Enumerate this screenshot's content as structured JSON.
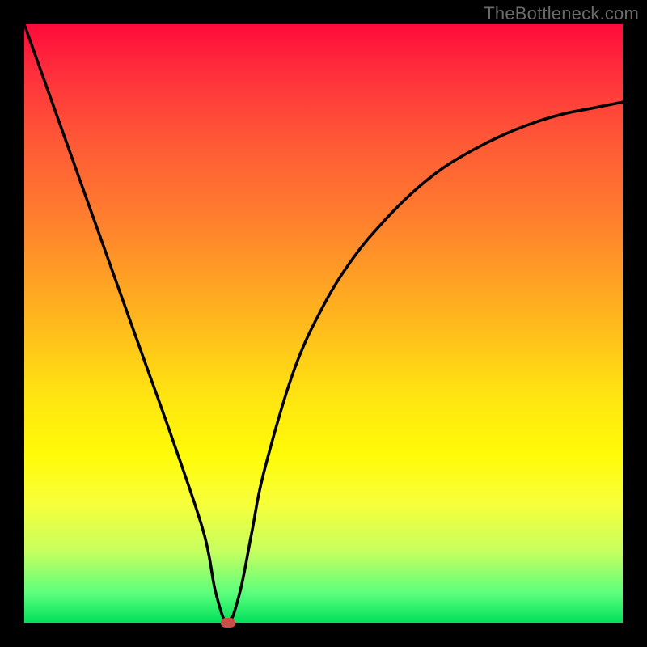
{
  "watermark": "TheBottleneck.com",
  "chart_data": {
    "type": "line",
    "title": "",
    "xlabel": "",
    "ylabel": "",
    "xlim": [
      0,
      100
    ],
    "ylim": [
      0,
      100
    ],
    "series": [
      {
        "name": "bottleneck-curve",
        "x": [
          0,
          5,
          10,
          15,
          20,
          25,
          30,
          32,
          34,
          36,
          38,
          40,
          45,
          50,
          55,
          60,
          65,
          70,
          75,
          80,
          85,
          90,
          95,
          100
        ],
        "values": [
          100,
          86,
          72,
          58,
          44,
          30,
          15,
          5,
          0,
          5,
          15,
          25,
          42,
          53,
          61,
          67,
          72,
          76,
          79,
          81.5,
          83.5,
          85,
          86,
          87
        ]
      }
    ],
    "marker": {
      "x": 34,
      "y": 0,
      "color": "#c94f46"
    },
    "grid": false,
    "legend": false
  },
  "colors": {
    "frame": "#000000",
    "curve": "#000000",
    "gradient_top": "#ff0a3a",
    "gradient_bottom": "#00e05a",
    "watermark": "#6b6b6b"
  }
}
